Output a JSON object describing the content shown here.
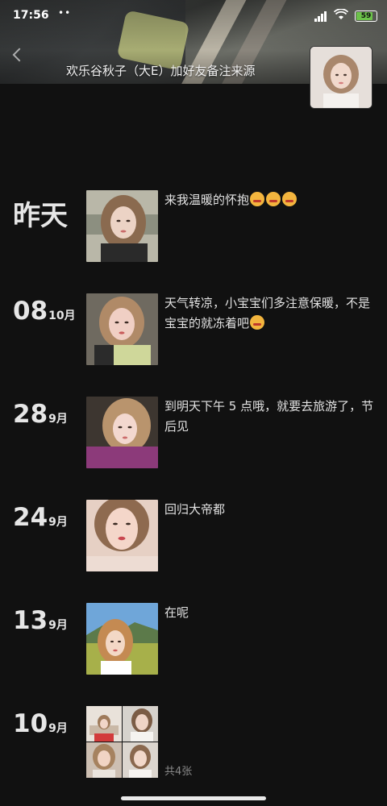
{
  "status_bar": {
    "time": "17:56",
    "dots": "••",
    "battery": "59"
  },
  "header": {
    "remark": "欢乐谷秋子（大E）加好友备注来源"
  },
  "posts": [
    {
      "day": "昨天",
      "month": "",
      "text": "来我温暖的怀抱",
      "emoji": [
        "grin-emoji",
        "grin-emoji",
        "grin-emoji"
      ],
      "count": ""
    },
    {
      "day": "08",
      "month": "10月",
      "text": "天气转凉，小宝宝们多注意保暖，不是宝宝的就冻着吧",
      "emoji": [
        "sweat-emoji"
      ],
      "count": ""
    },
    {
      "day": "28",
      "month": "9月",
      "text": "到明天下午 5 点哦，就要去旅游了，节后见",
      "emoji": [],
      "count": ""
    },
    {
      "day": "24",
      "month": "9月",
      "text": "回归大帝都",
      "emoji": [],
      "count": ""
    },
    {
      "day": "13",
      "month": "9月",
      "text": "在呢",
      "emoji": [],
      "count": ""
    },
    {
      "day": "10",
      "month": "9月",
      "text": "",
      "emoji": [],
      "count": "共4张"
    }
  ],
  "colors": {
    "background": "#111111",
    "text": "#e2e2e2",
    "muted": "#8a8a8a",
    "battery": "#6cc24a"
  }
}
